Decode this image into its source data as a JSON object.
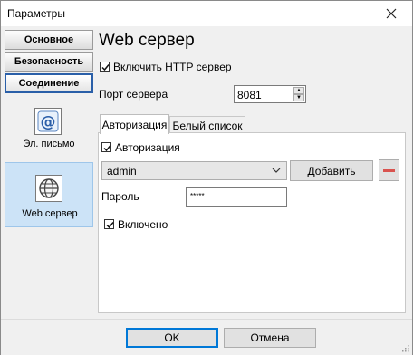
{
  "window": {
    "title": "Параметры"
  },
  "categories": [
    {
      "label": "Основное"
    },
    {
      "label": "Безопасность"
    },
    {
      "label": "Соединение"
    }
  ],
  "side_items": [
    {
      "label": "Эл. письмо",
      "icon": "email-at-icon"
    },
    {
      "label": "Web сервер",
      "icon": "globe-icon"
    }
  ],
  "main": {
    "title": "Web сервер",
    "enable_http_label": "Включить HTTP сервер",
    "enable_http_checked": true,
    "port_label": "Порт сервера",
    "port_value": "8081"
  },
  "tabs": [
    {
      "label": "Авторизация",
      "active": true
    },
    {
      "label": "Белый список",
      "active": false
    }
  ],
  "auth": {
    "auth_label": "Авторизация",
    "auth_checked": true,
    "user_select_value": "admin",
    "add_button": "Добавить",
    "password_label": "Пароль",
    "password_value": "*****",
    "enabled_label": "Включено",
    "enabled_checked": true
  },
  "footer": {
    "ok_button": "OK",
    "cancel_button": "Отмена"
  },
  "colors": {
    "selected_item_bg": "#cce3f7",
    "remove_accent": "#d9534f",
    "default_button_border": "#0078d7"
  }
}
